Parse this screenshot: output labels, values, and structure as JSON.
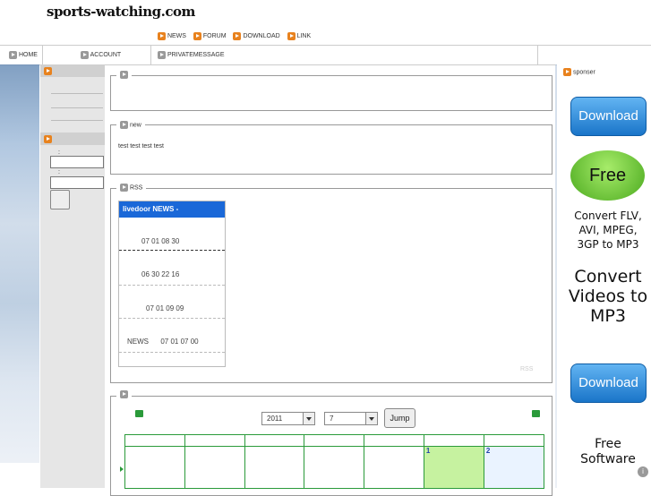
{
  "site": {
    "logo": "sports-watching.com"
  },
  "topnav": {
    "items": [
      "NEWS",
      "FORUM",
      "DOWNLOAD",
      "LINK"
    ]
  },
  "navbar": {
    "home": "HOME",
    "account": "ACCOUNT",
    "private_message": "PRIVATEMESSAGE"
  },
  "login": {
    "label_user": ":",
    "label_pass": ":"
  },
  "panels": {
    "new_title": "new",
    "new_body": "test test test test",
    "rss_title": "RSS"
  },
  "rss": {
    "header": "livedoor NEWS -",
    "rows": [
      "07 01 08 30",
      "06 30 22 16",
      "07 01 09 09",
      "NEWS      07 01 07 00"
    ],
    "link": "RSS"
  },
  "calendar": {
    "year": "2011",
    "month": "7",
    "jump_label": "Jump",
    "day1": "1",
    "day2": "2"
  },
  "sponsor": {
    "title": "sponser",
    "download_label": "Download",
    "free_label": "Free",
    "convert_line": "Convert FLV, AVI, MPEG, 3GP to MP3",
    "convert_big": "Convert Videos to MP3",
    "free_software": "Free Software"
  },
  "colors": {
    "accent_orange": "#e8821e",
    "rss_blue": "#1a68d8",
    "calendar_green": "#2a9a3a"
  }
}
